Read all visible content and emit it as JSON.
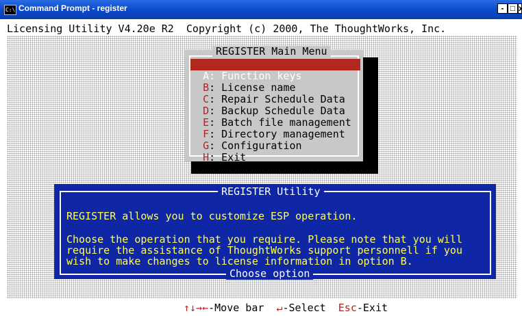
{
  "window": {
    "title": "Command Prompt - register",
    "app_icon": "C:\\",
    "controls": {
      "minimize": "-",
      "maximize": "□",
      "close": "x"
    }
  },
  "header": {
    "text": "Licensing Utility V4.20e R2  Copyright (c) 2000, The ThoughtWorks, Inc."
  },
  "menu": {
    "title": "REGISTER Main Menu",
    "items": [
      {
        "key": "A",
        "label": ": Function keys",
        "selected": true
      },
      {
        "key": "B",
        "label": ": License name"
      },
      {
        "key": "C",
        "label": ": Repair Schedule Data"
      },
      {
        "key": "D",
        "label": ": Backup Schedule Data"
      },
      {
        "key": "E",
        "label": ": Batch file management"
      },
      {
        "key": "F",
        "label": ": Directory management"
      },
      {
        "key": "G",
        "label": ": Configuration"
      },
      {
        "key": "H",
        "label": ": Exit"
      }
    ]
  },
  "info": {
    "title": "REGISTER Utility",
    "lines": [
      "REGISTER allows you to customize ESP operation.",
      "Choose the operation that you require. Please note that you will",
      "require the assistance of ThoughtWorks support personnell if you",
      "wish to make changes to license information in option B."
    ],
    "footer": "Choose option"
  },
  "status": {
    "arrows": "↑↓→←",
    "move_label": "-Move bar",
    "enter_symbol": "↵",
    "select_label": "-Select",
    "esc_key": "Esc",
    "exit_label": "-Exit"
  },
  "colors": {
    "titlebar": "#0a48c8",
    "menu_bg": "#c8c8c8",
    "selected_bg": "#b0281e",
    "hotkey": "#b22222",
    "info_bg": "#1027a5",
    "info_text": "#ffff54"
  }
}
